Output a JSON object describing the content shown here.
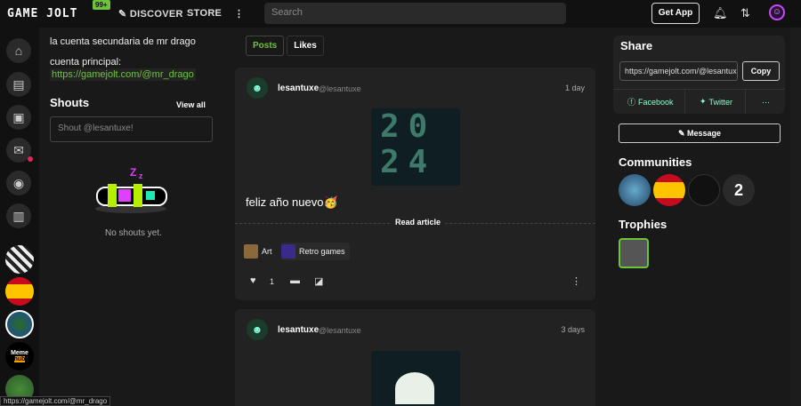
{
  "nav": {
    "logo": "GAME JOLT",
    "badge": "99+",
    "discover": "DISCOVER",
    "store": "STORE",
    "search_placeholder": "Search",
    "get_app": "Get App"
  },
  "profile": {
    "bio_line": "la cuenta secundaria de mr drago",
    "main_label": "cuenta principal:",
    "main_link": "https://gamejolt.com/@mr_drago"
  },
  "shouts": {
    "title": "Shouts",
    "view_all": "View all",
    "placeholder": "Shout @lesantuxe!",
    "empty": "No shouts yet."
  },
  "tabs": [
    "Posts",
    "Likes"
  ],
  "posts": [
    {
      "author": "lesantuxe",
      "handle": "@lesantuxe",
      "time": "1 day",
      "text": "feliz año nuevo🥳",
      "read_more": "Read article",
      "tags": [
        "Art",
        "Retro games"
      ],
      "likes": "1"
    },
    {
      "author": "lesantuxe",
      "handle": "@lesantuxe",
      "time": "3 days"
    }
  ],
  "share": {
    "title": "Share",
    "url": "https://gamejolt.com/@lesantuxe",
    "copy": "Copy",
    "facebook": "Facebook",
    "twitter": "Twitter",
    "more": "···"
  },
  "message": "Message",
  "communities_title": "Communities",
  "trophies_title": "Trophies",
  "status_url": "https://gamejolt.com/@mr_drago",
  "art_text": [
    "20",
    "24"
  ]
}
